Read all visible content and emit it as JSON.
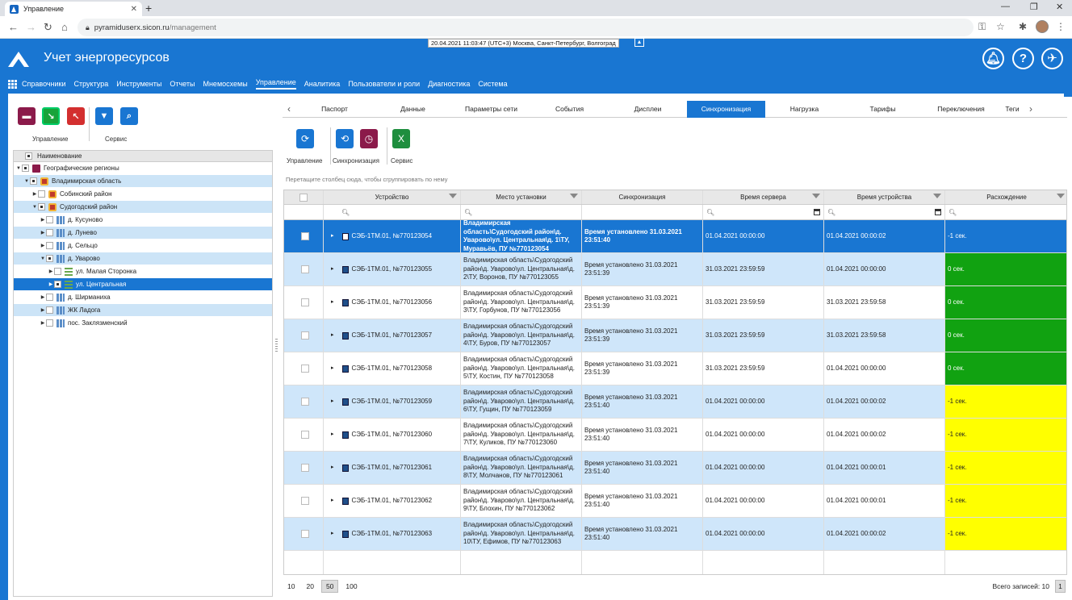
{
  "browser": {
    "tab_title": "Управление",
    "url_host": "pyramiduserx.sicon.ru",
    "url_path": "/management"
  },
  "app": {
    "title": "Учет энергоресурсов",
    "datetime": "20.04.2021 11:03:47 (UTC+3) Москва, Санкт-Петербург, Волгоград",
    "accent": "#1976d2",
    "menu": [
      "Справочники",
      "Структура",
      "Инструменты",
      "Отчеты",
      "Мнемосхемы",
      "Управление",
      "Аналитика",
      "Пользователи и роли",
      "Диагностика",
      "Система"
    ],
    "menu_active": "Управление"
  },
  "left_toolbar": {
    "group1_label": "Управление",
    "group2_label": "Сервис"
  },
  "tree": {
    "header": "Наименование",
    "nodes": [
      {
        "label": "Географические регионы"
      },
      {
        "label": "Владимирская область"
      },
      {
        "label": "Собинский район"
      },
      {
        "label": "Судогодский район"
      },
      {
        "label": "д. Кусуново"
      },
      {
        "label": "д. Лунево"
      },
      {
        "label": "д. Сельцо"
      },
      {
        "label": "д. Уварово"
      },
      {
        "label": "ул. Малая Сторонка"
      },
      {
        "label": "ул. Центральная"
      },
      {
        "label": "д. Ширманиха"
      },
      {
        "label": "ЖК Ладога"
      },
      {
        "label": "пос. Заклязменский"
      }
    ]
  },
  "tabs": [
    "Паспорт",
    "Данные",
    "Параметры сети",
    "События",
    "Дисплеи",
    "Синхронизация",
    "Нагрузка",
    "Тарифы",
    "Переключения",
    "Теги"
  ],
  "tabs_active": "Синхронизация",
  "right_toolbar": {
    "g1": "Управление",
    "g2": "Синхронизация",
    "g3": "Сервис"
  },
  "group_hint": "Перетащите столбец сюда, чтобы сгруппировать по нему",
  "grid": {
    "columns": [
      "Устройство",
      "Место установки",
      "Синхронизация",
      "Время сервера",
      "Время устройства",
      "Расхождение"
    ],
    "rows": [
      {
        "device": "СЭБ-1ТМ.01, №770123054",
        "place": "Владимирская область\\Судогодский район\\д. Уварово\\ул. Центральная\\д. 1\\ТУ, Муравьёв, ПУ №770123054",
        "sync": "Время установлено 31.03.2021 23:51:40",
        "server": "01.04.2021 00:00:00",
        "dev": "01.04.2021 00:00:02",
        "diff": "-1 сек.",
        "status": "selected"
      },
      {
        "device": "СЭБ-1ТМ.01, №770123055",
        "place": "Владимирская область\\Судогодский район\\д. Уварово\\ул. Центральная\\д. 2\\ТУ, Воронов, ПУ №770123055",
        "sync": "Время установлено 31.03.2021 23:51:39",
        "server": "31.03.2021 23:59:59",
        "dev": "01.04.2021 00:00:00",
        "diff": "0 сек.",
        "status": "green"
      },
      {
        "device": "СЭБ-1ТМ.01, №770123056",
        "place": "Владимирская область\\Судогодский район\\д. Уварово\\ул. Центральная\\д. 3\\ТУ, Горбунов, ПУ №770123056",
        "sync": "Время установлено 31.03.2021 23:51:39",
        "server": "31.03.2021 23:59:59",
        "dev": "31.03.2021 23:59:58",
        "diff": "0 сек.",
        "status": "green"
      },
      {
        "device": "СЭБ-1ТМ.01, №770123057",
        "place": "Владимирская область\\Судогодский район\\д. Уварово\\ул. Центральная\\д. 4\\ТУ, Буров, ПУ №770123057",
        "sync": "Время установлено 31.03.2021 23:51:39",
        "server": "31.03.2021 23:59:59",
        "dev": "31.03.2021 23:59:58",
        "diff": "0 сек.",
        "status": "green"
      },
      {
        "device": "СЭБ-1ТМ.01, №770123058",
        "place": "Владимирская область\\Судогодский район\\д. Уварово\\ул. Центральная\\д. 5\\ТУ, Костин, ПУ №770123058",
        "sync": "Время установлено 31.03.2021 23:51:39",
        "server": "31.03.2021 23:59:59",
        "dev": "01.04.2021 00:00:00",
        "diff": "0 сек.",
        "status": "green"
      },
      {
        "device": "СЭБ-1ТМ.01, №770123059",
        "place": "Владимирская область\\Судогодский район\\д. Уварово\\ул. Центральная\\д. 6\\ТУ, Гущин, ПУ №770123059",
        "sync": "Время установлено 31.03.2021 23:51:40",
        "server": "01.04.2021 00:00:00",
        "dev": "01.04.2021 00:00:02",
        "diff": "-1 сек.",
        "status": "yellow"
      },
      {
        "device": "СЭБ-1ТМ.01, №770123060",
        "place": "Владимирская область\\Судогодский район\\д. Уварово\\ул. Центральная\\д. 7\\ТУ, Куликов, ПУ №770123060",
        "sync": "Время установлено 31.03.2021 23:51:40",
        "server": "01.04.2021 00:00:00",
        "dev": "01.04.2021 00:00:02",
        "diff": "-1 сек.",
        "status": "yellow"
      },
      {
        "device": "СЭБ-1ТМ.01, №770123061",
        "place": "Владимирская область\\Судогодский район\\д. Уварово\\ул. Центральная\\д. 8\\ТУ, Молчанов, ПУ №770123061",
        "sync": "Время установлено 31.03.2021 23:51:40",
        "server": "01.04.2021 00:00:00",
        "dev": "01.04.2021 00:00:01",
        "diff": "-1 сек.",
        "status": "yellow"
      },
      {
        "device": "СЭБ-1ТМ.01, №770123062",
        "place": "Владимирская область\\Судогодский район\\д. Уварово\\ул. Центральная\\д. 9\\ТУ, Блохин, ПУ №770123062",
        "sync": "Время установлено 31.03.2021 23:51:40",
        "server": "01.04.2021 00:00:00",
        "dev": "01.04.2021 00:00:01",
        "diff": "-1 сек.",
        "status": "yellow"
      },
      {
        "device": "СЭБ-1ТМ.01, №770123063",
        "place": "Владимирская область\\Судогодский район\\д. Уварово\\ул. Центральная\\д. 10\\ТУ, Ефимов, ПУ №770123063",
        "sync": "Время установлено 31.03.2021 23:51:40",
        "server": "01.04.2021 00:00:00",
        "dev": "01.04.2021 00:00:02",
        "diff": "-1 сек.",
        "status": "yellow"
      }
    ]
  },
  "pager": {
    "sizes": [
      "10",
      "20",
      "50",
      "100"
    ],
    "active_size": "50",
    "total": "Всего записей: 10",
    "page": "1"
  },
  "colors": {
    "green": "#11a211",
    "yellow": "#ffff00",
    "selected": "#1976d2",
    "alt": "#cfe6fa"
  }
}
